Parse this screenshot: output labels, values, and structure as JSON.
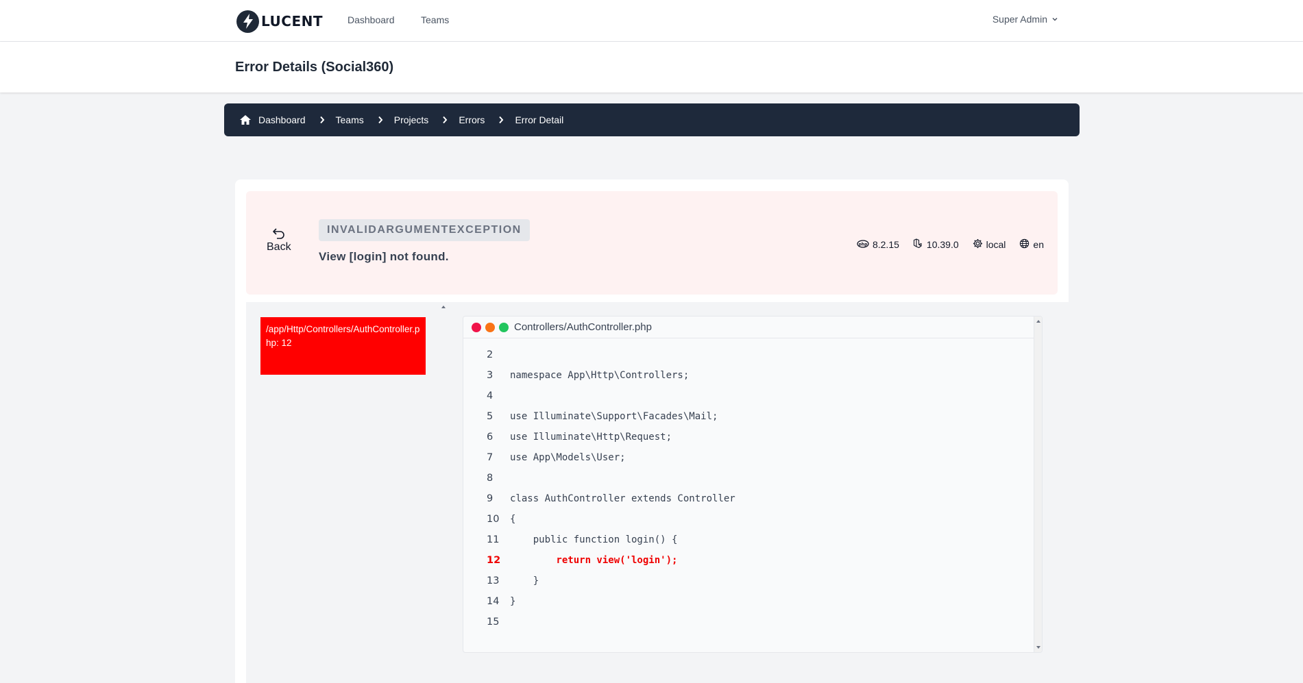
{
  "nav": {
    "logo_text": "LUCENT",
    "links": [
      "Dashboard",
      "Teams"
    ],
    "user_label": "Super Admin"
  },
  "header": {
    "title": "Error Details (Social360)"
  },
  "breadcrumb": {
    "items": [
      "Dashboard",
      "Teams",
      "Projects",
      "Errors",
      "Error Detail"
    ]
  },
  "error": {
    "back_label": "Back",
    "exception_type": "INVALIDARGUMENTEXCEPTION",
    "message": "View [login] not found.",
    "php_version": "8.2.15",
    "laravel_version": "10.39.0",
    "environment": "local",
    "locale": "en"
  },
  "stack": {
    "frames": [
      {
        "label": "/app/Http/Controllers/AuthController.php: 12"
      }
    ]
  },
  "code": {
    "filename": "Controllers/AuthController.php",
    "highlight_line": 12,
    "dot_colors": [
      "#f0144a",
      "#f97316",
      "#22c55e"
    ],
    "lines": [
      {
        "n": "2",
        "text": ""
      },
      {
        "n": "3",
        "text": "namespace App\\Http\\Controllers;"
      },
      {
        "n": "4",
        "text": ""
      },
      {
        "n": "5",
        "text": "use Illuminate\\Support\\Facades\\Mail;"
      },
      {
        "n": "6",
        "text": "use Illuminate\\Http\\Request;"
      },
      {
        "n": "7",
        "text": "use App\\Models\\User;"
      },
      {
        "n": "8",
        "text": ""
      },
      {
        "n": "9",
        "text": "class AuthController extends Controller"
      },
      {
        "n": "10",
        "text": "{"
      },
      {
        "n": "11",
        "text": "    public function login() {"
      },
      {
        "n": "12",
        "text": "        return view('login');"
      },
      {
        "n": "13",
        "text": "    }"
      },
      {
        "n": "14",
        "text": "}"
      },
      {
        "n": "15",
        "text": ""
      }
    ]
  }
}
